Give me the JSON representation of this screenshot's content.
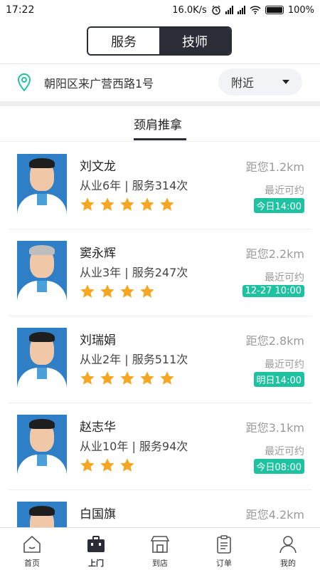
{
  "status_bar": {
    "time": "17:22",
    "speed": "16.0K/s",
    "battery": "100%"
  },
  "header": {
    "segments": [
      {
        "label": "服务",
        "active": false
      },
      {
        "label": "技师",
        "active": true
      }
    ]
  },
  "location": {
    "address": "朝阳区来广营西路1号",
    "filter": "附近"
  },
  "category_tabs": [
    {
      "label": "颈肩推拿",
      "active": true
    }
  ],
  "technicians": [
    {
      "name": "刘文龙",
      "meta": "从业6年 | 服务314次",
      "stars": 5,
      "distance": "距您1.2km",
      "soonest_label": "最近可约",
      "soonest_time": "今日14:00"
    },
    {
      "name": "窦永辉",
      "meta": "从业3年 | 服务247次",
      "stars": 4,
      "distance": "距您2.2km",
      "soonest_label": "最近可约",
      "soonest_time": "12-27 10:00"
    },
    {
      "name": "刘瑞娟",
      "meta": "从业2年 | 服务511次",
      "stars": 5,
      "distance": "距您2.8km",
      "soonest_label": "最近可约",
      "soonest_time": "明日14:00"
    },
    {
      "name": "赵志华",
      "meta": "从业10年 | 服务94次",
      "stars": 3,
      "distance": "距您3.1km",
      "soonest_label": "最近可约",
      "soonest_time": "今日08:00"
    },
    {
      "name": "白国旗",
      "meta": "",
      "stars": 0,
      "distance": "距您4.2km",
      "soonest_label": "",
      "soonest_time": ""
    }
  ],
  "bottom_nav": [
    {
      "label": "首页",
      "icon": "home-icon",
      "active": false
    },
    {
      "label": "上门",
      "icon": "briefcase-icon",
      "active": true
    },
    {
      "label": "到店",
      "icon": "store-icon",
      "active": false
    },
    {
      "label": "订单",
      "icon": "clipboard-icon",
      "active": false
    },
    {
      "label": "我的",
      "icon": "person-icon",
      "active": false
    }
  ],
  "colors": {
    "dark": "#2a2d36",
    "accent": "#1fc2a0",
    "star": "#f5a623"
  }
}
